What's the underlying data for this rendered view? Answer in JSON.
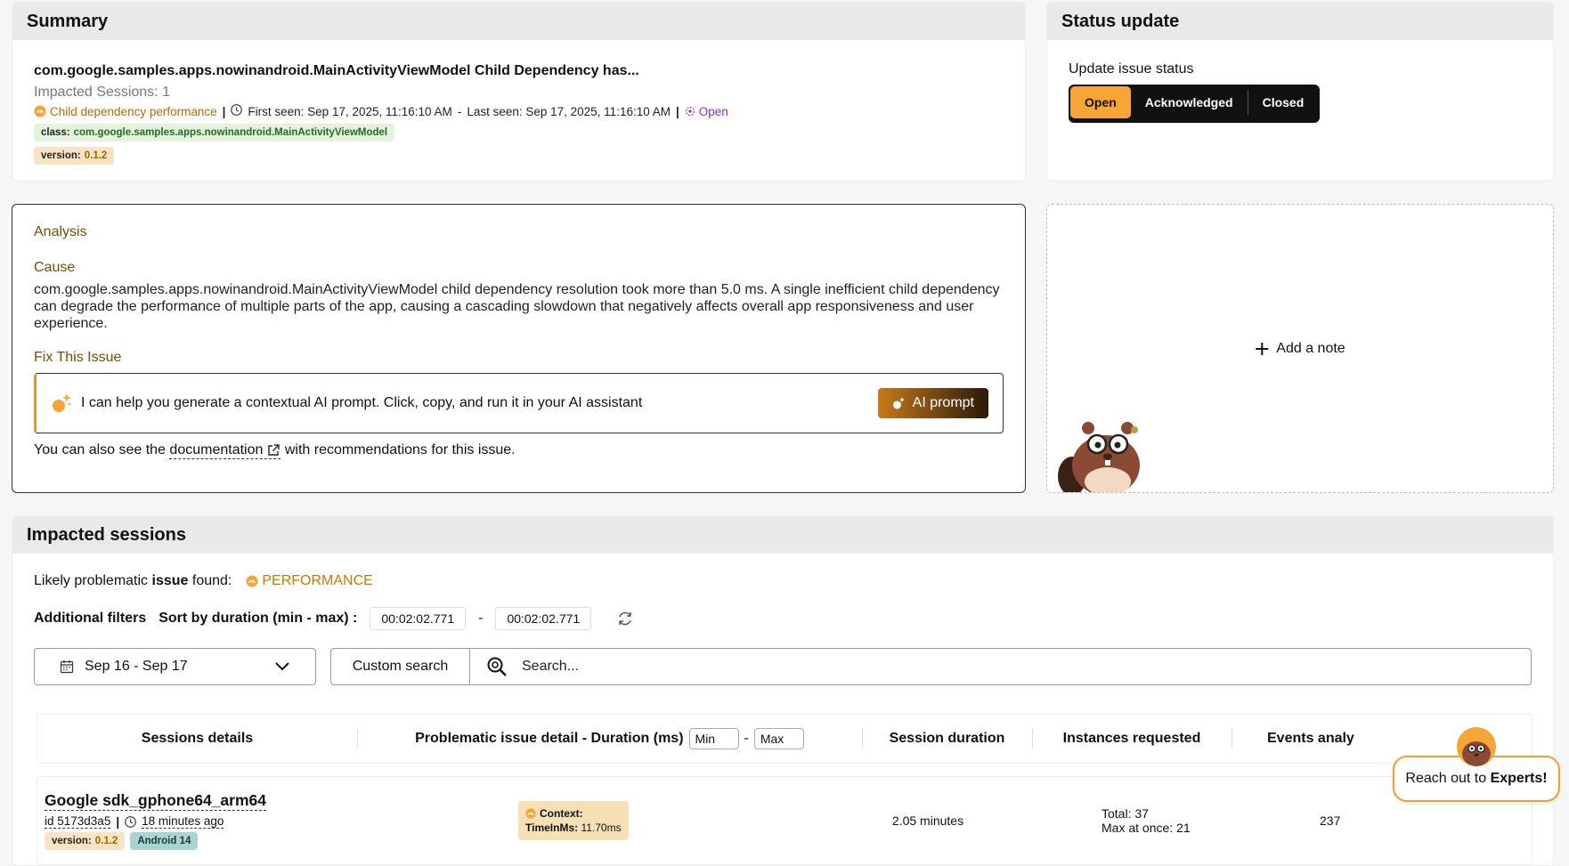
{
  "summary": {
    "header": "Summary",
    "title": "com.google.samples.apps.nowinandroid.MainActivityViewModel Child Dependency has...",
    "impacted": "Impacted Sessions: 1",
    "type_label": "Child dependency performance",
    "first_seen": "First seen: Sep 17, 2025, 11:16:10 AM",
    "dash": "-",
    "last_seen": "Last seen: Sep 17, 2025, 11:16:10 AM",
    "status": "Open",
    "class_key": "class:",
    "class_value": "com.google.samples.apps.nowinandroid.MainActivityViewModel",
    "version_key": "version:",
    "version_value": "0.1.2"
  },
  "status_update": {
    "header": "Status update",
    "label": "Update issue status",
    "options": [
      "Open",
      "Acknowledged",
      "Closed"
    ],
    "selected": "Open"
  },
  "analysis": {
    "heading": "Analysis",
    "cause_heading": "Cause",
    "cause_text": "com.google.samples.apps.nowinandroid.MainActivityViewModel child dependency resolution took more than 5.0 ms. A single inefficient child dependency can degrade the performance of multiple parts of the app, causing a cascading slowdown that negatively affects overall app responsiveness and user experience.",
    "fix_heading": "Fix This Issue",
    "ai_message": "I can help you generate a contextual AI prompt. Click, copy, and run it in your AI assistant",
    "ai_button": "AI prompt",
    "doc_prefix": "You can also see the",
    "doc_link": "documentation",
    "doc_suffix": "with recommendations for this issue."
  },
  "note": {
    "add_label": "Add a note"
  },
  "sessions": {
    "header": "Impacted sessions",
    "likely_prefix": "Likely problematic",
    "likely_bold": "issue",
    "likely_suffix": "found:",
    "likely_value": "PERFORMANCE",
    "additional_filters": "Additional filters",
    "sort_label": "Sort by duration (min - max) :",
    "duration_min": "00:02:02.771",
    "duration_sep": "-",
    "duration_max": "00:02:02.771",
    "date_range": "Sep 16 - Sep 17",
    "custom_search": "Custom search",
    "search_placeholder": "Search...",
    "columns": {
      "details": "Sessions details",
      "problem": "Problematic issue detail - Duration (ms)",
      "min_placeholder": "Min",
      "minmax_sep": "-",
      "max_placeholder": "Max",
      "duration": "Session duration",
      "instances": "Instances requested",
      "events": "Events analy"
    },
    "rows": [
      {
        "device": "Google sdk_gphone64_arm64",
        "id": "id 5173d3a5",
        "ago": "18 minutes ago",
        "version_key": "version:",
        "version_value": "0.1.2",
        "os": "Android 14",
        "ctx_label": "Context:",
        "ctx_key": "TimeInMs:",
        "ctx_value": "11.70ms",
        "duration": "2.05 minutes",
        "instances_total": "Total: 37",
        "instances_max": "Max at once: 21",
        "events": "237"
      }
    ]
  },
  "experts": {
    "prefix": "Reach out to",
    "bold": "Experts!"
  },
  "colors": {
    "accent": "#f7a534",
    "analysis_heading": "#7a4b00",
    "open_status": "#8a2be2"
  }
}
